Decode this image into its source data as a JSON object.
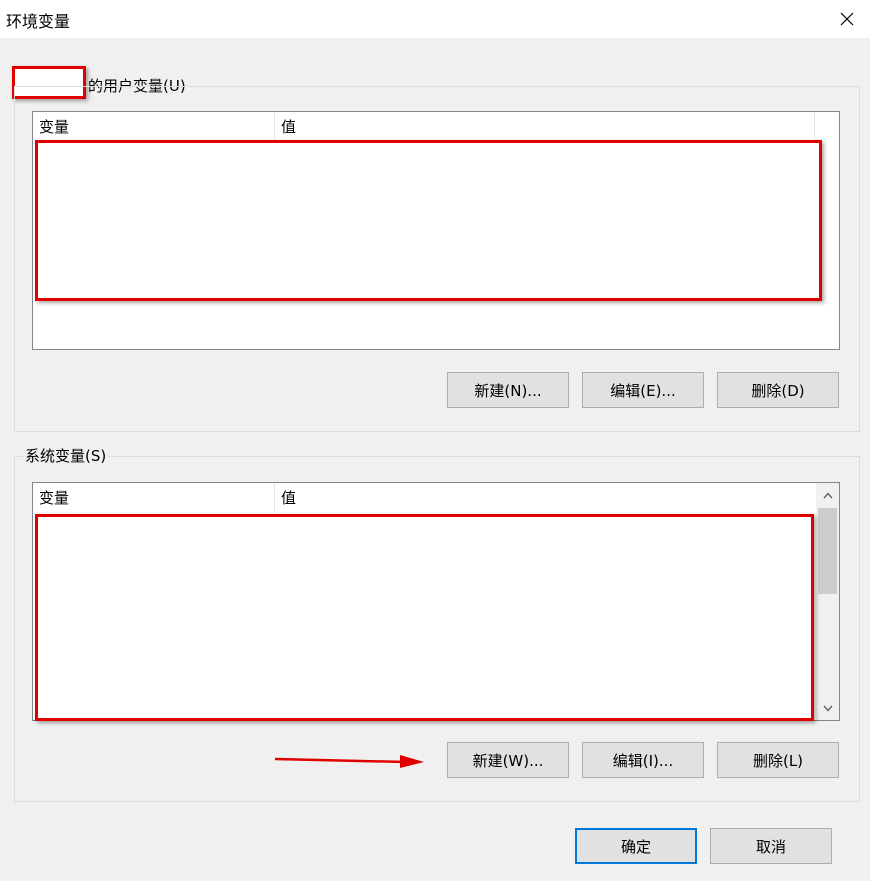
{
  "window": {
    "title": "环境变量"
  },
  "user_vars": {
    "group_label": "的用户变量(U)",
    "columns": [
      "变量",
      "值"
    ],
    "buttons": {
      "new": "新建(N)...",
      "edit": "编辑(E)...",
      "delete": "删除(D)"
    }
  },
  "system_vars": {
    "group_label": "系统变量(S)",
    "columns": [
      "变量",
      "值"
    ],
    "buttons": {
      "new": "新建(W)...",
      "edit": "编辑(I)...",
      "delete": "删除(L)"
    }
  },
  "footer": {
    "ok": "确定",
    "cancel": "取消"
  },
  "colors": {
    "annotation_red": "#e00000",
    "accent": "#0078d7"
  }
}
